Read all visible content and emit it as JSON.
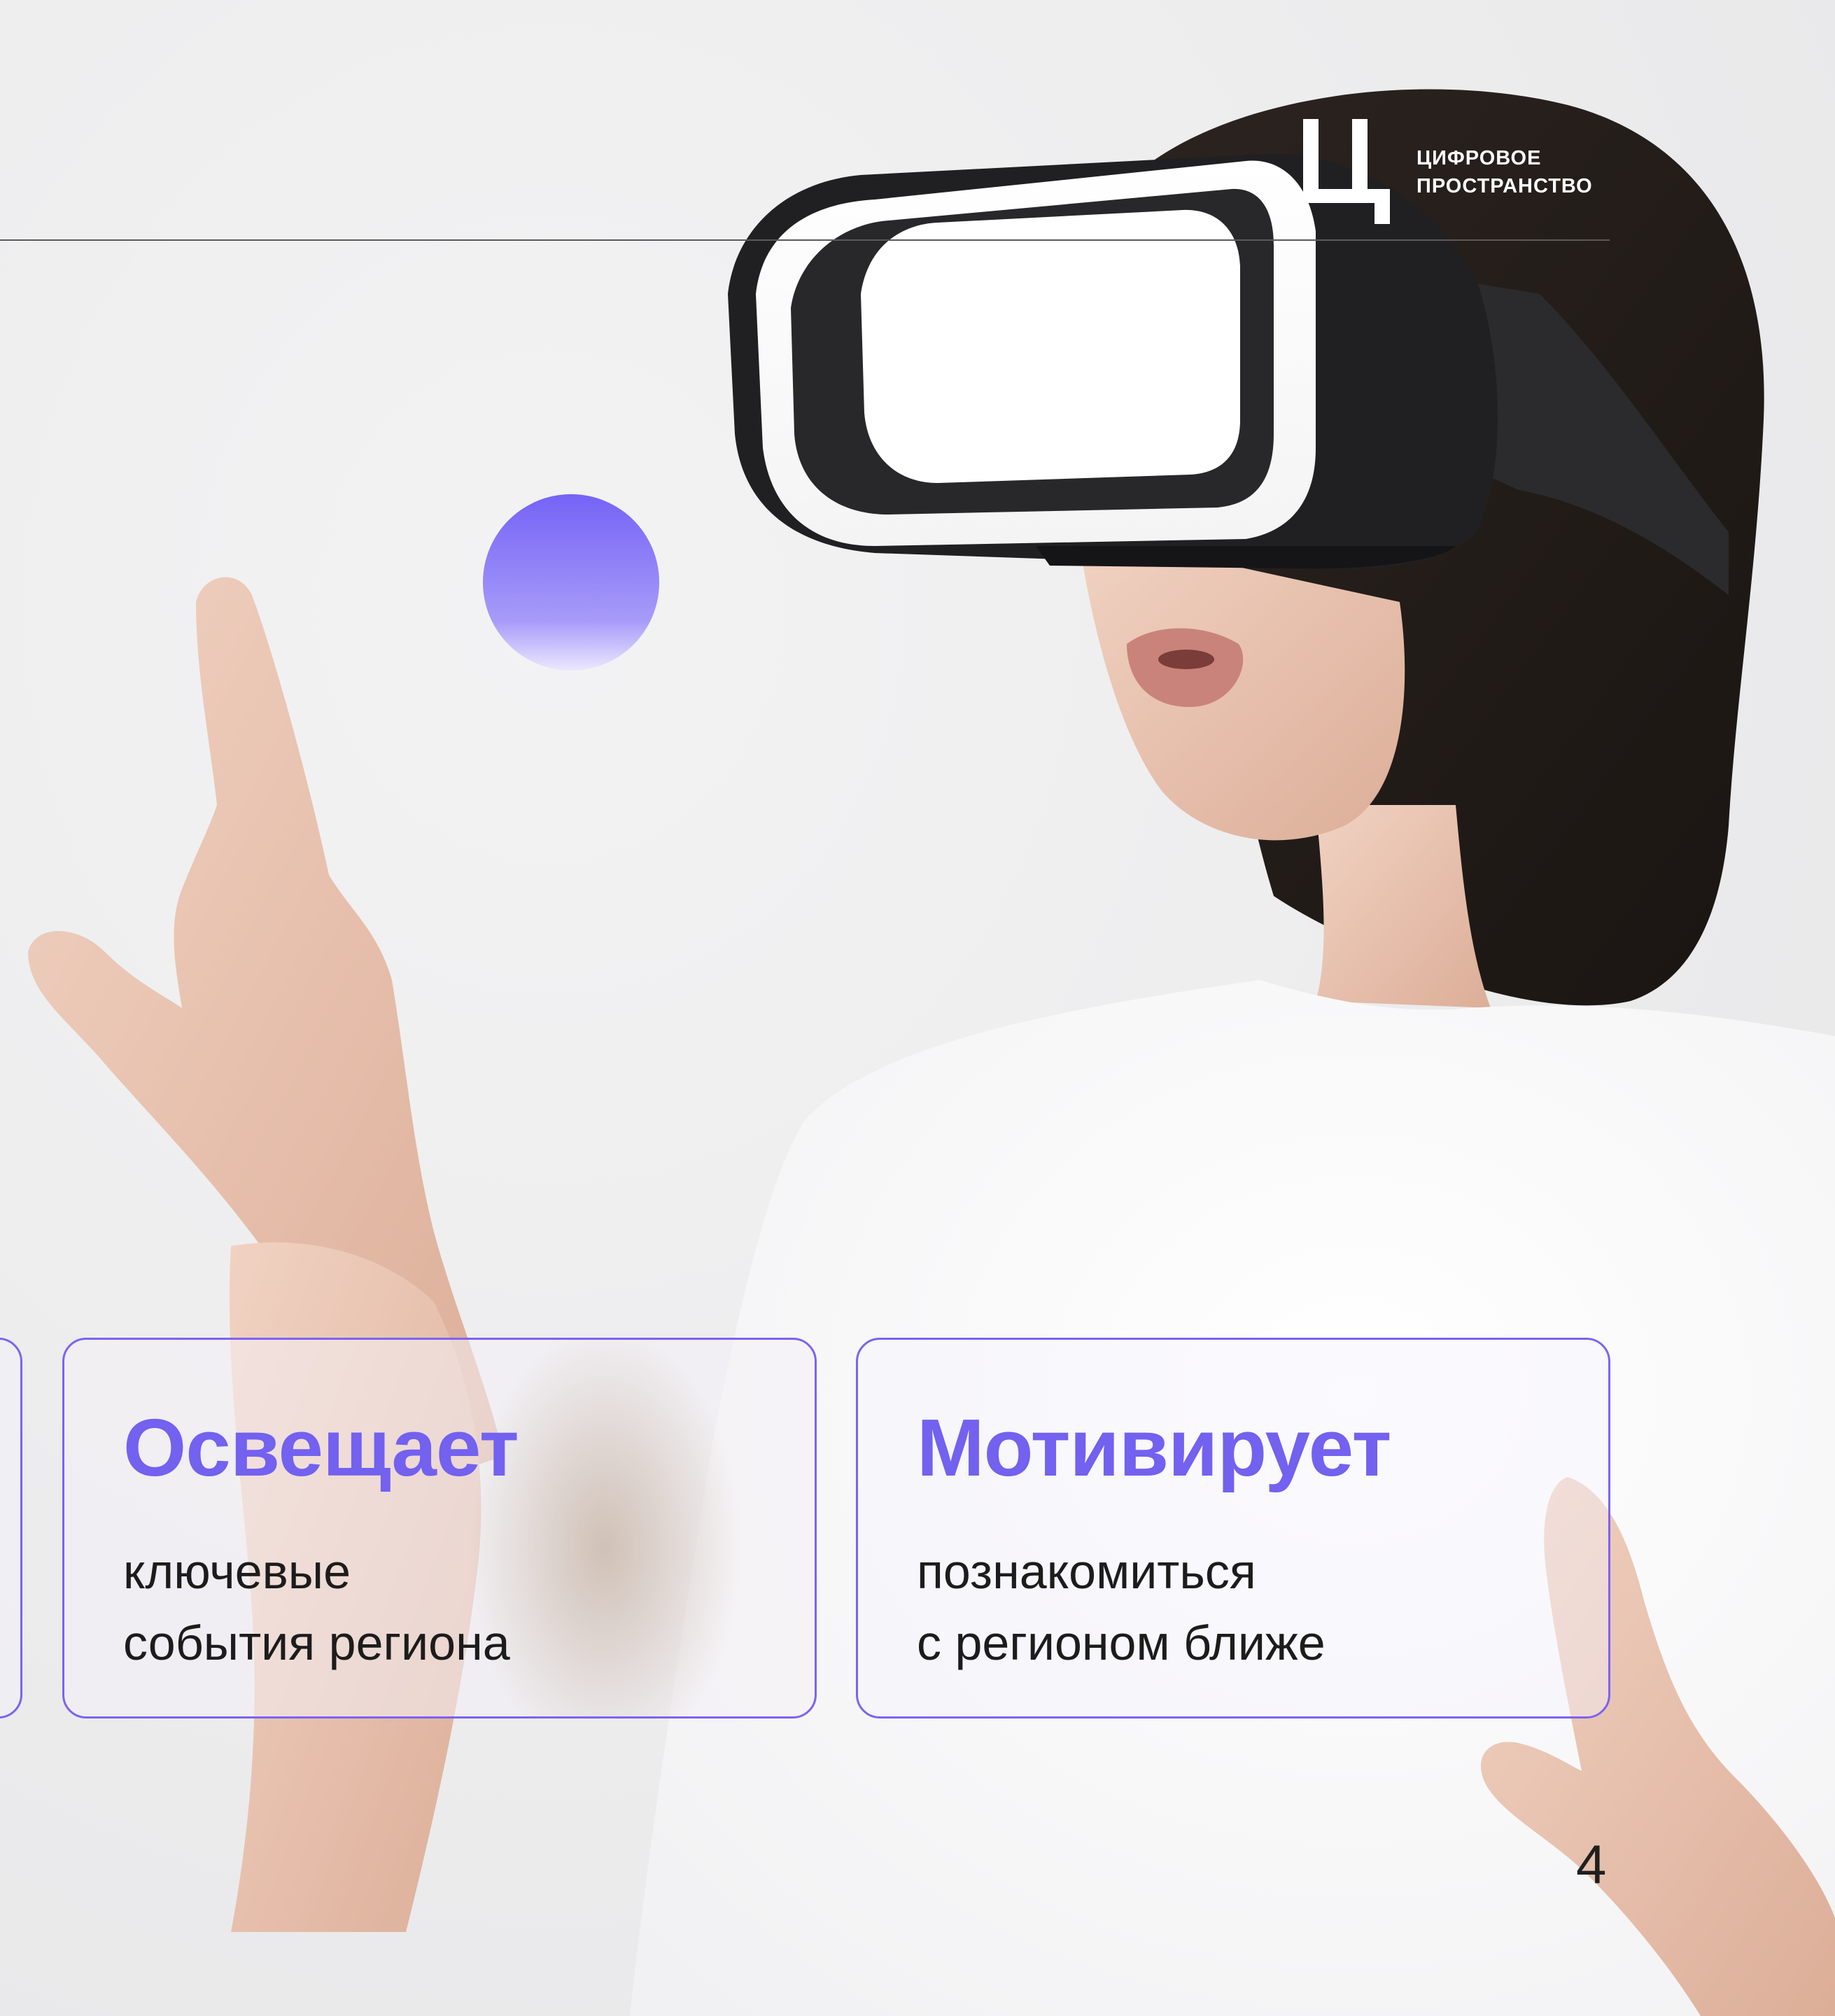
{
  "logo": {
    "line1": "ЦИФРОВОЕ",
    "line2": "ПРОСТРАНСТВО"
  },
  "cards": [
    {
      "title": "Освещает",
      "line1": "ключевые",
      "line2": "события региона"
    },
    {
      "title": "Мотивирует",
      "line1": "познакомиться",
      "line2": "с регионом ближе"
    }
  ],
  "page_number": "4",
  "colors": {
    "accent": "#7361ef",
    "card_border": "#7a64f2",
    "text": "#1c1c1c",
    "logo_text": "#ffffff"
  }
}
